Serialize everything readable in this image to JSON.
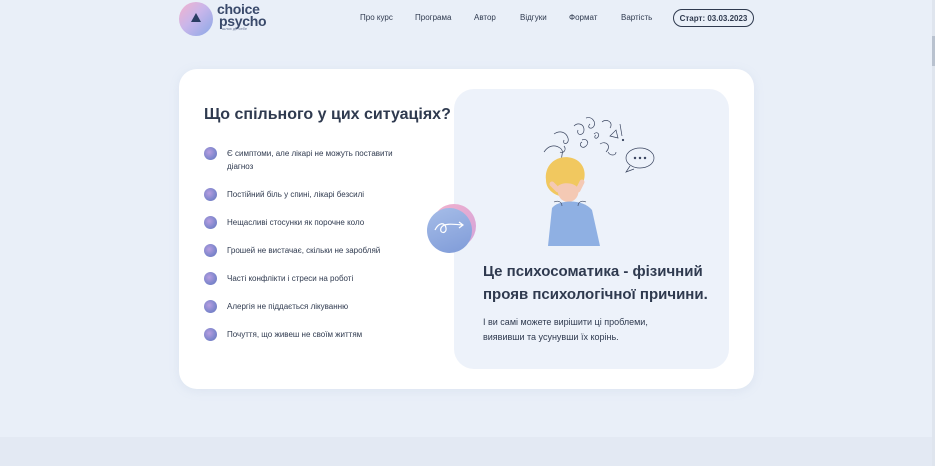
{
  "brand": {
    "logo_line1": "choice",
    "logo_line2": "psycho",
    "logo_tagline": "шлях до себе"
  },
  "nav": {
    "items": [
      {
        "label": "Про курс"
      },
      {
        "label": "Програма"
      },
      {
        "label": "Автор"
      },
      {
        "label": "Відгуки"
      },
      {
        "label": "Формат"
      },
      {
        "label": "Вартість"
      }
    ],
    "start_button": "Старт: 03.03.2023"
  },
  "section": {
    "title": "Що спільного у цих ситуаціях?",
    "items": [
      "Є симптоми, але лікарі не можуть поставити діагноз",
      "Постійний біль у спині, лікарі безсилі",
      "Нещасливі стосунки як порочне коло",
      "Грошей не вистачає, скільки не заробляй",
      "Часті конфлікти і стреси на роботі",
      "Алергія не піддається лікуванню",
      "Почуття, що живеш не своїм життям"
    ]
  },
  "panel": {
    "heading": "Це психосоматика - фізичний прояв психологічної причини.",
    "text": "І ви самі можете вирішити ці проблеми, виявивши та усунувши їх корінь.",
    "illustration_icon": "stressed-woman-illustration",
    "decor_icon": "swirl-arrow-icon"
  },
  "colors": {
    "background": "#e9eff8",
    "card": "#ffffff",
    "panel": "#edf2fa",
    "text": "#2f3a4f",
    "bullet": "#7d86cc",
    "accent_pink": "#f3b2cc",
    "accent_blue": "#8aa8e7"
  }
}
